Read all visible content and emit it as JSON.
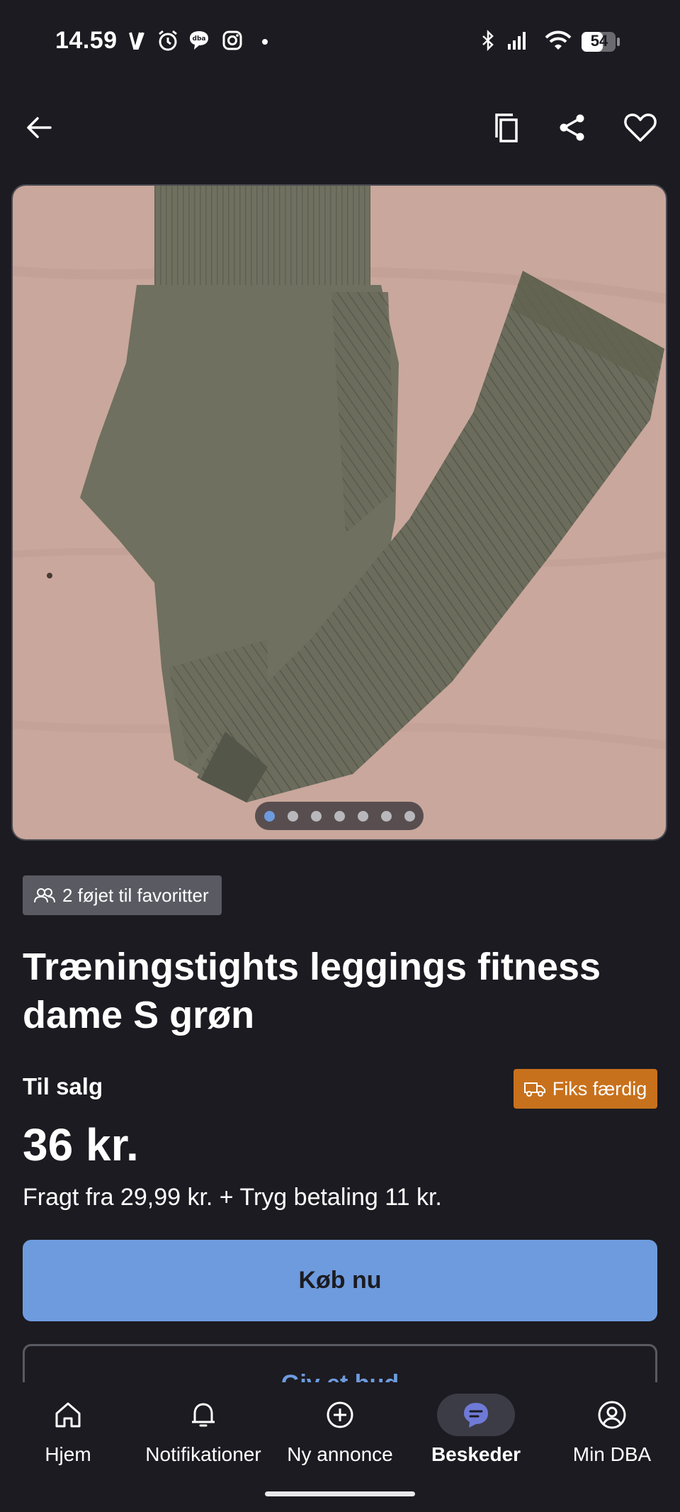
{
  "status_bar": {
    "time": "14.59",
    "battery": "54"
  },
  "favorites": {
    "text": "2 føjet til favoritter"
  },
  "listing": {
    "title": "Træningstights leggings fitness dame S grøn",
    "status": "Til salg",
    "fiks_badge": "Fiks færdig",
    "price": "36 kr.",
    "shipping": "Fragt fra 29,99 kr. + Tryg betaling 11 kr."
  },
  "image": {
    "dot_count": 7,
    "active_index": 0,
    "image_position_fraction": 0.143
  },
  "actions": {
    "buy": "Køb nu",
    "bid": "Giv et bud"
  },
  "nav": {
    "items": [
      {
        "label": "Hjem",
        "icon": "home-icon"
      },
      {
        "label": "Notifikationer",
        "icon": "bell-icon"
      },
      {
        "label": "Ny annonce",
        "icon": "plus-circle-icon"
      },
      {
        "label": "Beskeder",
        "icon": "chat-bubble-icon",
        "active": true
      },
      {
        "label": "Min DBA",
        "icon": "user-circle-icon"
      }
    ]
  },
  "colors": {
    "background": "#1c1b21",
    "accent": "#6e9bde",
    "badge_orange": "#c8711d"
  }
}
